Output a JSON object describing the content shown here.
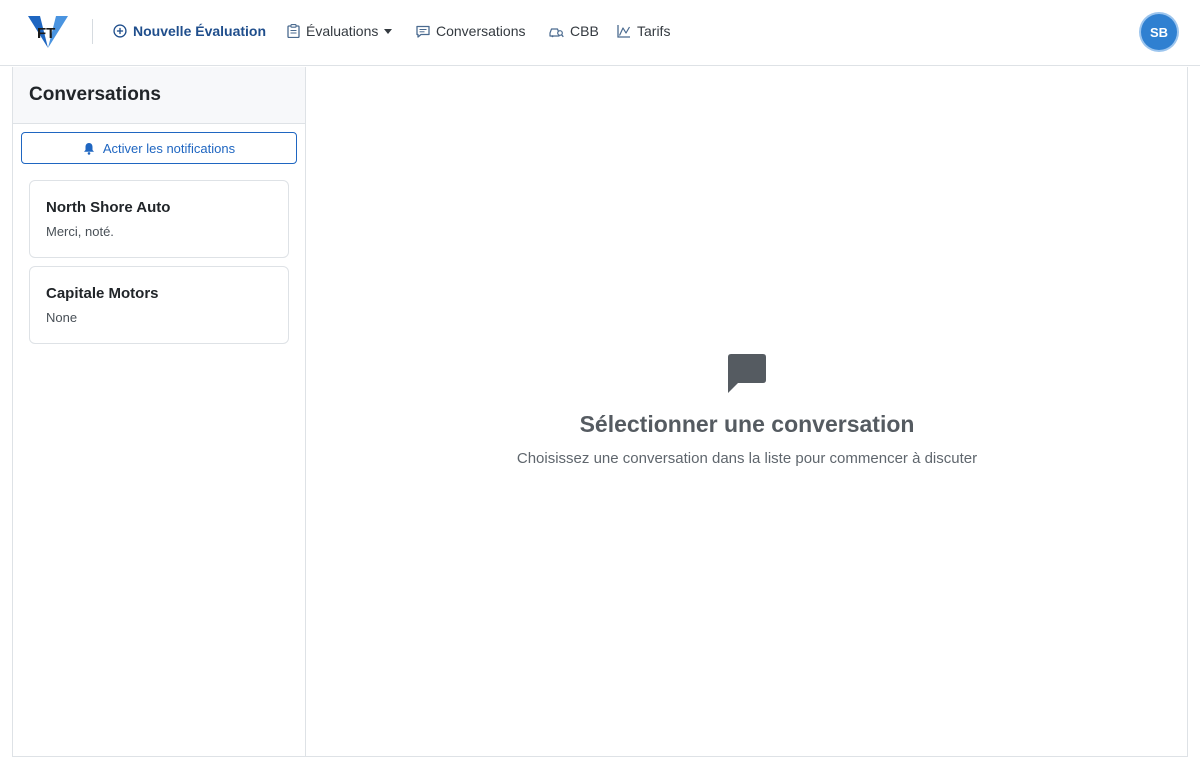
{
  "navbar": {
    "logo_text": "FT",
    "items": [
      {
        "label": "Nouvelle Évaluation",
        "icon": "plus-circle-icon"
      },
      {
        "label": "Évaluations",
        "icon": "clipboard-icon"
      },
      {
        "label": "Conversations",
        "icon": "chat-icon"
      },
      {
        "label": "CBB",
        "icon": "car-search-icon"
      },
      {
        "label": "Tarifs",
        "icon": "chart-icon"
      }
    ],
    "avatar_initials": "SB"
  },
  "sidebar": {
    "title": "Conversations",
    "notif_button": "Activer les notifications",
    "conversations": [
      {
        "name": "North Shore Auto",
        "preview": "Merci, noté."
      },
      {
        "name": "Capitale Motors",
        "preview": "None"
      }
    ]
  },
  "main": {
    "empty_title": "Sélectionner une conversation",
    "empty_subtitle": "Choisissez une conversation dans la liste pour commencer à discuter"
  },
  "colors": {
    "accent": "#1f66c1",
    "brand_dark": "#1f4e8c",
    "avatar": "#2f80d1"
  }
}
